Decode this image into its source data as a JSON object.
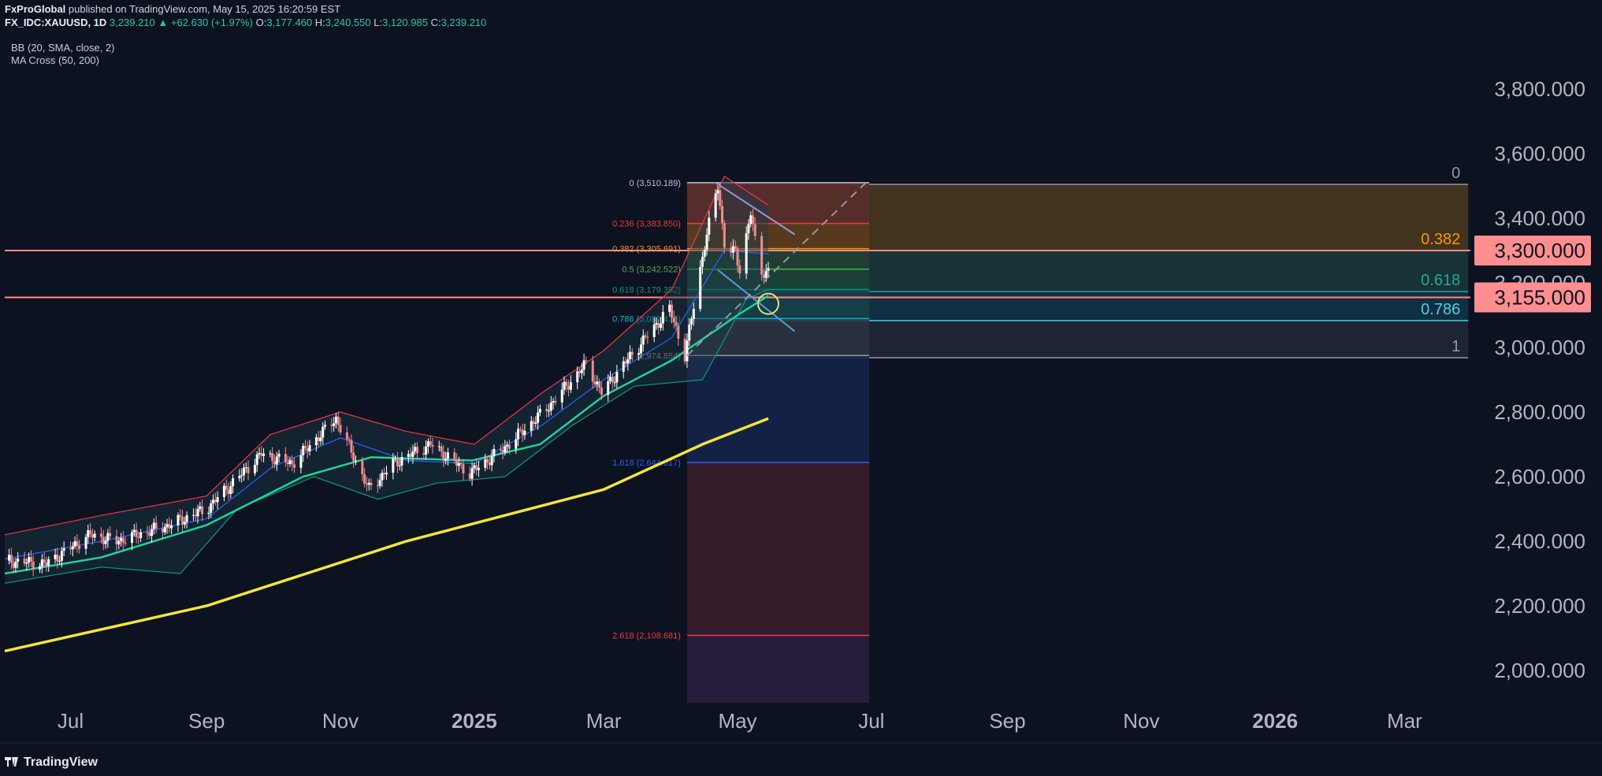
{
  "header": {
    "publisher": "FxProGlobal",
    "published_text": "published on TradingView.com, May 15, 2025 16:20:59 EST",
    "symbol": "FX_IDC:XAUUSD, 1D",
    "price": "3,239.210",
    "change": "▲ +62.630 (+1.97%)",
    "open_label": "O:",
    "open": "3,177.460",
    "high_label": "H:",
    "high": "3,240.550",
    "low_label": "L:",
    "low": "3,120.985",
    "close_label": "C:",
    "close": "3,239.210"
  },
  "indicators": [
    "BB (20, SMA, close, 2)",
    "MA Cross (50, 200)"
  ],
  "footer": {
    "brand": "TradingView"
  },
  "colors": {
    "background": "#0c1220",
    "candle_up": "#ffffff",
    "candle_down": "#f28b8b",
    "bb_upper": "#f23645",
    "bb_basis": "#2962ff",
    "bb_lower": "#089981",
    "ma50": "#1fd39a",
    "ma200": "#f5e43c",
    "hline": "#ff8a8a",
    "price_label": "#ff8f8f"
  },
  "chart_data": {
    "type": "candlestick",
    "symbol": "XAUUSD",
    "timeframe": "1D",
    "y_axis": {
      "ticks": [
        2000,
        2200,
        2400,
        2600,
        2800,
        3000,
        3200,
        3400,
        3600,
        3800
      ],
      "tick_labels": [
        "2,000.000",
        "2,200.000",
        "2,400.000",
        "2,600.000",
        "2,800.000",
        "3,000.000",
        "3,200.000",
        "3,400.000",
        "3,600.000",
        "3,800.000"
      ],
      "range": [
        1900,
        3920
      ]
    },
    "x_axis": {
      "range": [
        "2024-06-01",
        "2026-03-31"
      ],
      "ticks": [
        {
          "date": "2024-07-01",
          "label": "Jul",
          "bold": false
        },
        {
          "date": "2024-09-01",
          "label": "Sep",
          "bold": false
        },
        {
          "date": "2024-11-01",
          "label": "Nov",
          "bold": false
        },
        {
          "date": "2025-01-01",
          "label": "2025",
          "bold": true
        },
        {
          "date": "2025-03-01",
          "label": "Mar",
          "bold": false
        },
        {
          "date": "2025-05-01",
          "label": "May",
          "bold": false
        },
        {
          "date": "2025-07-01",
          "label": "Jul",
          "bold": false
        },
        {
          "date": "2025-09-01",
          "label": "Sep",
          "bold": false
        },
        {
          "date": "2025-11-01",
          "label": "Nov",
          "bold": false
        },
        {
          "date": "2026-01-01",
          "label": "2026",
          "bold": true
        },
        {
          "date": "2026-03-01",
          "label": "Mar",
          "bold": false
        }
      ]
    },
    "price_path": [
      [
        "2024-06-01",
        2340
      ],
      [
        "2024-06-20",
        2330
      ],
      [
        "2024-07-10",
        2420
      ],
      [
        "2024-07-22",
        2400
      ],
      [
        "2024-08-15",
        2450
      ],
      [
        "2024-09-01",
        2500
      ],
      [
        "2024-09-26",
        2670
      ],
      [
        "2024-10-10",
        2640
      ],
      [
        "2024-10-30",
        2780
      ],
      [
        "2024-11-14",
        2560
      ],
      [
        "2024-11-25",
        2640
      ],
      [
        "2024-12-12",
        2700
      ],
      [
        "2024-12-30",
        2610
      ],
      [
        "2025-01-15",
        2690
      ],
      [
        "2025-02-03",
        2810
      ],
      [
        "2025-02-21",
        2950
      ],
      [
        "2025-02-28",
        2860
      ],
      [
        "2025-03-14",
        2980
      ],
      [
        "2025-03-31",
        3120
      ],
      [
        "2025-04-07",
        2975
      ],
      [
        "2025-04-16",
        3320
      ],
      [
        "2025-04-22",
        3500
      ],
      [
        "2025-04-25",
        3320
      ],
      [
        "2025-04-30",
        3290
      ],
      [
        "2025-05-02",
        3240
      ],
      [
        "2025-05-07",
        3420
      ],
      [
        "2025-05-09",
        3325
      ],
      [
        "2025-05-12",
        3230
      ],
      [
        "2025-05-15",
        3240
      ]
    ],
    "bb_upper": [
      [
        "2024-06-01",
        2420
      ],
      [
        "2024-07-15",
        2480
      ],
      [
        "2024-09-01",
        2540
      ],
      [
        "2024-09-30",
        2730
      ],
      [
        "2024-11-01",
        2800
      ],
      [
        "2024-12-01",
        2740
      ],
      [
        "2025-01-01",
        2700
      ],
      [
        "2025-02-01",
        2860
      ],
      [
        "2025-03-01",
        2990
      ],
      [
        "2025-04-01",
        3180
      ],
      [
        "2025-04-25",
        3530
      ],
      [
        "2025-05-15",
        3440
      ]
    ],
    "bb_lower": [
      [
        "2024-06-01",
        2270
      ],
      [
        "2024-07-15",
        2320
      ],
      [
        "2024-08-20",
        2300
      ],
      [
        "2024-09-15",
        2500
      ],
      [
        "2024-10-20",
        2600
      ],
      [
        "2024-11-18",
        2530
      ],
      [
        "2024-12-15",
        2580
      ],
      [
        "2025-01-15",
        2600
      ],
      [
        "2025-02-15",
        2760
      ],
      [
        "2025-03-15",
        2880
      ],
      [
        "2025-04-15",
        2900
      ],
      [
        "2025-05-05",
        3150
      ],
      [
        "2025-05-15",
        3180
      ]
    ],
    "bb_basis": [
      [
        "2024-06-01",
        2345
      ],
      [
        "2024-07-15",
        2400
      ],
      [
        "2024-09-01",
        2470
      ],
      [
        "2024-10-01",
        2630
      ],
      [
        "2024-11-01",
        2720
      ],
      [
        "2024-12-01",
        2650
      ],
      [
        "2025-01-01",
        2640
      ],
      [
        "2025-02-01",
        2760
      ],
      [
        "2025-03-01",
        2900
      ],
      [
        "2025-04-01",
        3030
      ],
      [
        "2025-04-25",
        3300
      ],
      [
        "2025-05-15",
        3290
      ]
    ],
    "ma50": [
      [
        "2024-06-01",
        2300
      ],
      [
        "2024-07-15",
        2350
      ],
      [
        "2024-09-01",
        2450
      ],
      [
        "2024-10-15",
        2600
      ],
      [
        "2024-11-15",
        2660
      ],
      [
        "2024-12-31",
        2650
      ],
      [
        "2025-01-31",
        2700
      ],
      [
        "2025-03-01",
        2850
      ],
      [
        "2025-04-01",
        2960
      ],
      [
        "2025-05-01",
        3100
      ],
      [
        "2025-05-15",
        3160
      ]
    ],
    "ma200": [
      [
        "2024-06-01",
        2060
      ],
      [
        "2024-09-01",
        2200
      ],
      [
        "2024-12-01",
        2400
      ],
      [
        "2025-03-01",
        2560
      ],
      [
        "2025-04-15",
        2700
      ],
      [
        "2025-05-15",
        2780
      ]
    ],
    "horizontal_lines": [
      3300,
      3155
    ],
    "price_labels": [
      "3,300.000",
      "3,155.000"
    ],
    "fib_retracement_large": {
      "start_date": "2025-04-08",
      "end_date": "2026-03-30",
      "levels": [
        {
          "ratio": 0,
          "price": 3505,
          "label": "0",
          "color": "#9598a1",
          "fill": "#4b3a1f"
        },
        {
          "ratio": 0.382,
          "price": 3300,
          "label": "0.382",
          "color": "#ff9800",
          "fill": "#1a3a3a"
        },
        {
          "ratio": 0.618,
          "price": 3173,
          "label": "0.618",
          "color": "#26a69a",
          "fill": "#133549"
        },
        {
          "ratio": 0.786,
          "price": 3083,
          "label": "0.786",
          "color": "#4dd0e1",
          "fill": "#212838"
        },
        {
          "ratio": 1,
          "price": 2968,
          "label": "1",
          "color": "#9598a1",
          "fill": ""
        }
      ]
    },
    "fib_extension": {
      "start_date": "2025-04-08",
      "end_date": "2025-06-30",
      "levels": [
        {
          "ratio": 0,
          "price": 3510.189,
          "label": "0 (3,510.189)",
          "color": "#c0c3cc"
        },
        {
          "ratio": 0.236,
          "price": 3383.85,
          "label": "0.236 (3,383.850)",
          "color": "#f23645"
        },
        {
          "ratio": 0.382,
          "price": 3305.691,
          "label": "0.382 (3,305.691)",
          "color": "#ff9800"
        },
        {
          "ratio": 0.5,
          "price": 3242.522,
          "label": "0.5 (3,242.522)",
          "color": "#4caf50"
        },
        {
          "ratio": 0.618,
          "price": 3179.352,
          "label": "0.618 (3,179.352)",
          "color": "#089981"
        },
        {
          "ratio": 0.786,
          "price": 3089.416,
          "label": "0.786 (3,089.416)",
          "color": "#00bcd4"
        },
        {
          "ratio": 1,
          "price": 2974.854,
          "label": "1 (2,974.854)",
          "color": "#9598a1"
        },
        {
          "ratio": 1.618,
          "price": 2644.017,
          "label": "1.618 (2,644.017)",
          "color": "#2962ff"
        },
        {
          "ratio": 2.618,
          "price": 2108.681,
          "label": "2.618 (2,108.681)",
          "color": "#f23645"
        }
      ],
      "zones": [
        {
          "from": 3510.189,
          "to": 3383.85,
          "fill": "#5a2c2c"
        },
        {
          "from": 3383.85,
          "to": 3305.691,
          "fill": "#5a3a1e"
        },
        {
          "from": 3305.691,
          "to": 3242.522,
          "fill": "#224030"
        },
        {
          "from": 3242.522,
          "to": 3179.352,
          "fill": "#1b4236"
        },
        {
          "from": 3179.352,
          "to": 3089.416,
          "fill": "#154049"
        },
        {
          "from": 3089.416,
          "to": 2974.854,
          "fill": "#2b3340"
        },
        {
          "from": 2974.854,
          "to": 2644.017,
          "fill": "#15244a"
        },
        {
          "from": 2644.017,
          "to": 2108.681,
          "fill": "#3a1e2c"
        },
        {
          "from": 2108.681,
          "to": 1900,
          "fill": "#2a1f3d"
        }
      ]
    },
    "trend_lines": [
      {
        "from": [
          "2025-04-21",
          3510
        ],
        "to": [
          "2025-05-27",
          3350
        ],
        "color": "#8f9bd6"
      },
      {
        "from": [
          "2025-04-22",
          3240
        ],
        "to": [
          "2025-05-27",
          3050
        ],
        "color": "#5b9bd5"
      },
      {
        "from": [
          "2025-04-08",
          2975
        ],
        "to": [
          "2025-06-30",
          3520
        ],
        "color": "#9598a1",
        "dashed": true
      }
    ],
    "marker_circle": {
      "date": "2025-05-15",
      "price": 3135
    }
  }
}
